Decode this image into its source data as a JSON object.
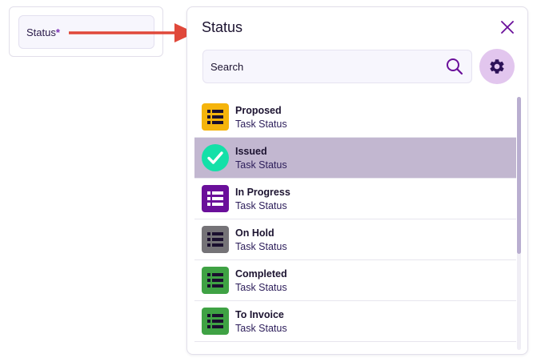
{
  "field": {
    "label": "Status",
    "required_mark": "*"
  },
  "panel": {
    "title": "Status",
    "close_icon": "close-icon",
    "search": {
      "placeholder": "Search",
      "value": "",
      "icon": "search-icon"
    },
    "settings_icon": "gear-icon"
  },
  "items": [
    {
      "name": "Proposed",
      "subtitle": "Task Status",
      "color": "#f5b40c",
      "icon": "list-icon",
      "selected": false
    },
    {
      "name": "Issued",
      "subtitle": "Task Status",
      "color": "#14e0a8",
      "icon": "check-circle-icon",
      "selected": true
    },
    {
      "name": "In Progress",
      "subtitle": "Task Status",
      "color": "#6a0f9a",
      "icon": "list-icon",
      "selected": false
    },
    {
      "name": "On Hold",
      "subtitle": "Task Status",
      "color": "#757377",
      "icon": "list-icon",
      "selected": false
    },
    {
      "name": "Completed",
      "subtitle": "Task Status",
      "color": "#3fa244",
      "icon": "list-icon",
      "selected": false
    },
    {
      "name": "To Invoice",
      "subtitle": "Task Status",
      "color": "#3fa244",
      "icon": "list-icon",
      "selected": false
    }
  ],
  "colors": {
    "accent": "#6a0f9a",
    "selected_row": "#c2b7d0",
    "settings_button": "#e2c6ee",
    "arrow": "#e0483a"
  }
}
